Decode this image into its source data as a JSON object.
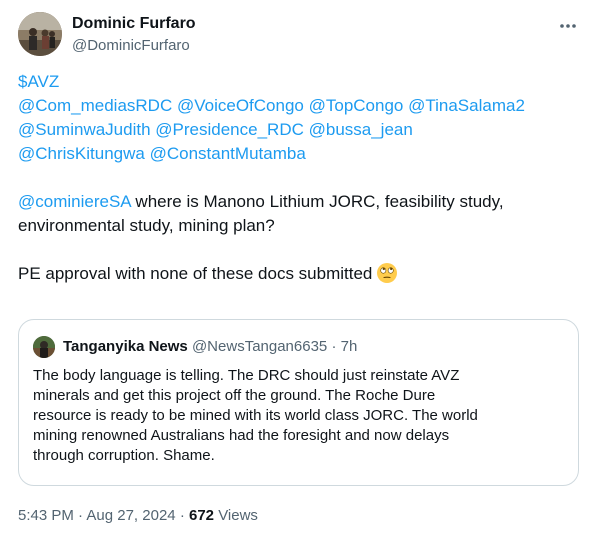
{
  "author": {
    "name": "Dominic Furfaro",
    "handle": "@DominicFurfaro",
    "avatar_icon": "profile-photo"
  },
  "more_icon": "more-horizontal-icon",
  "tweet": {
    "cashtag": "$AVZ",
    "mention_lines": [
      [
        "@Com_mediasRDC",
        "@VoiceOfCongo",
        "@TopCongo",
        "@TinaSalama2"
      ],
      [
        "@SuminwaJudith",
        "@Presidence_RDC",
        "@bussa_jean"
      ],
      [
        "@ChrisKitungwa",
        "@ConstantMutamba"
      ]
    ],
    "p1_mention": "@cominiereSA",
    "p1_text_line1": " where is Manono Lithium JORC, feasibility study,",
    "p1_text_line2": "environmental study, mining plan?",
    "p2_text": "PE approval with none of these docs submitted",
    "p2_emoji": "face-with-rolling-eyes-emoji"
  },
  "quote": {
    "author_name": "Tanganyika News",
    "handle": "@NewsTangan6635",
    "separator": "·",
    "time": "7h",
    "lines": [
      "The body language is telling. The DRC should just reinstate AVZ",
      "minerals and get this project off the ground. The Roche Dure",
      "resource is ready to be mined with its world class JORC. The world",
      "mining renowned Australians had the foresight and now delays",
      "through corruption. Shame."
    ]
  },
  "footer": {
    "time": "5:43 PM",
    "separator": "·",
    "date": "Aug 27, 2024",
    "separator2": "·",
    "views_count": "672",
    "views_label": "Views"
  },
  "colors": {
    "link": "#1d9bf0",
    "text": "#0f1419",
    "secondary": "#536471",
    "border": "#cfd9de"
  }
}
